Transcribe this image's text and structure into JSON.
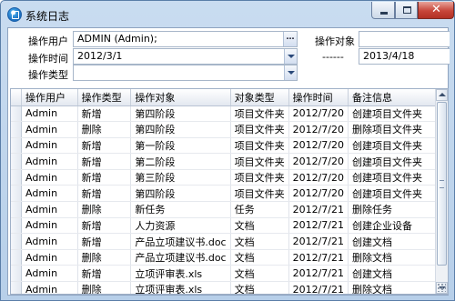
{
  "window": {
    "title": "系统日志",
    "colors": {
      "frame": "#b7cfe9",
      "close": "#c7463a"
    }
  },
  "filters": {
    "user_label": "操作用户",
    "user_value": "ADMIN (Admin);",
    "time_label": "操作时间",
    "time_from": "2012/3/1",
    "time_sep": "------",
    "time_to": "2013/4/18",
    "type_label": "操作类型",
    "type_value": "",
    "object_label": "操作对象",
    "object_value": ""
  },
  "grid": {
    "columns": [
      "操作用户",
      "操作类型",
      "操作对象",
      "对象类型",
      "操作时间",
      "备注信息"
    ],
    "rows": [
      [
        "Admin",
        "新增",
        "第四阶段",
        "项目文件夹",
        "2012/7/20",
        "创建项目文件夹"
      ],
      [
        "Admin",
        "删除",
        "第四阶段",
        "项目文件夹",
        "2012/7/20",
        "删除项目文件夹"
      ],
      [
        "Admin",
        "新增",
        "第一阶段",
        "项目文件夹",
        "2012/7/20",
        "创建项目文件夹"
      ],
      [
        "Admin",
        "新增",
        "第二阶段",
        "项目文件夹",
        "2012/7/20",
        "创建项目文件夹"
      ],
      [
        "Admin",
        "新增",
        "第三阶段",
        "项目文件夹",
        "2012/7/20",
        "创建项目文件夹"
      ],
      [
        "Admin",
        "新增",
        "第四阶段",
        "项目文件夹",
        "2012/7/20",
        "创建项目文件夹"
      ],
      [
        "Admin",
        "删除",
        "新任务",
        "任务",
        "2012/7/21",
        "删除任务"
      ],
      [
        "Admin",
        "新增",
        "人力资源",
        "文档",
        "2012/7/21",
        "创建企业设备"
      ],
      [
        "Admin",
        "新增",
        "产品立项建议书.doc",
        "文档",
        "2012/7/21",
        "创建文档"
      ],
      [
        "Admin",
        "删除",
        "产品立项建议书.doc",
        "文档",
        "2012/7/21",
        "删除文档"
      ],
      [
        "Admin",
        "新增",
        "立项评审表.xls",
        "文档",
        "2012/7/21",
        "创建文档"
      ],
      [
        "Admin",
        "删除",
        "立项评审表.xls",
        "文档",
        "2012/7/21",
        "删除文档"
      ]
    ]
  }
}
